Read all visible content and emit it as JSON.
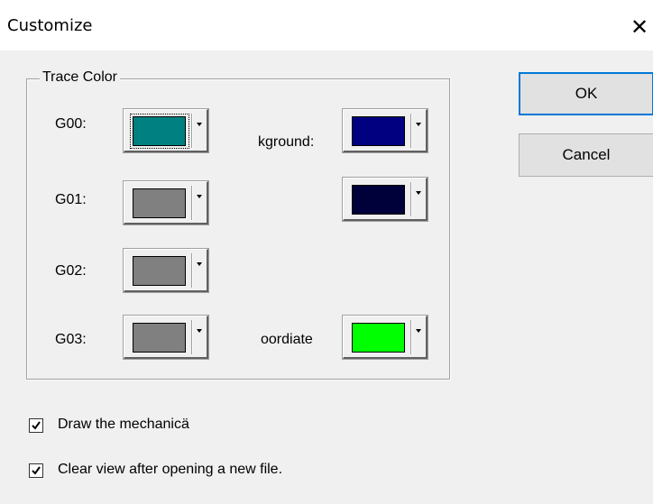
{
  "window": {
    "title": "Customize",
    "close_glyph": "✕"
  },
  "trace_group": {
    "legend": "Trace Color",
    "rows": [
      {
        "label": "G00:",
        "color": "#008080"
      },
      {
        "label": "G01:",
        "color": "#808080"
      },
      {
        "label": "G02:",
        "color": "#808080"
      },
      {
        "label": "G03:",
        "color": "#808080"
      }
    ],
    "right": [
      {
        "label": "kground:",
        "color": "#000080"
      },
      {
        "label": "",
        "color": "#00003a"
      },
      {
        "label": "oordiate",
        "color": "#00ff00"
      }
    ]
  },
  "buttons": {
    "ok": "OK",
    "cancel": "Cancel"
  },
  "options": {
    "draw_mechanical": {
      "label": "Draw the mechanicä",
      "checked": true
    },
    "clear_view": {
      "label": "Clear view after opening a new file.",
      "checked": true
    }
  }
}
